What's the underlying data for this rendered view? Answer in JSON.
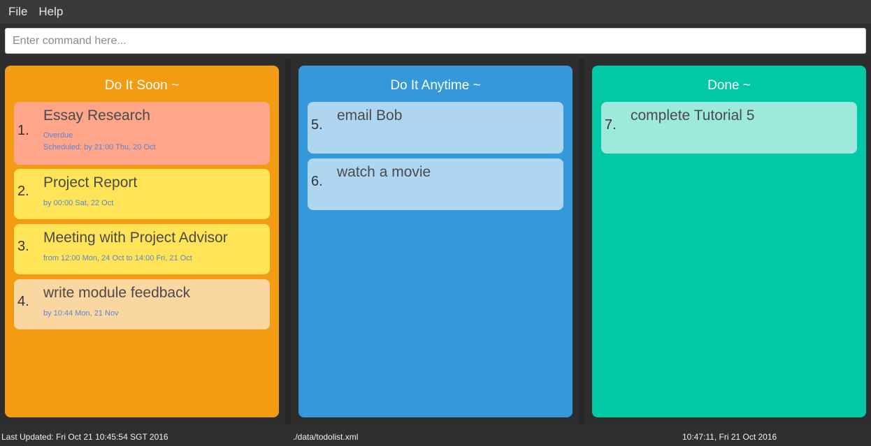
{
  "menu": {
    "file": "File",
    "help": "Help"
  },
  "command": {
    "placeholder": "Enter command here...",
    "value": ""
  },
  "panels": [
    {
      "title": "Do It Soon ~",
      "color": "#f39c12",
      "cards": [
        {
          "num": "1.",
          "title": "Essay Research",
          "lines": [
            "Overdue",
            "Scheduled: by 21:00 Thu, 20 Oct"
          ],
          "color": "#ffa58a"
        },
        {
          "num": "2.",
          "title": "Project Report",
          "lines": [
            "by 00:00 Sat, 22 Oct"
          ],
          "color": "#ffe457"
        },
        {
          "num": "3.",
          "title": "Meeting with Project Advisor",
          "lines": [
            "from 12:00 Mon, 24 Oct to 14:00 Fri, 21 Oct"
          ],
          "color": "#ffe457"
        },
        {
          "num": "4.",
          "title": "write module feedback",
          "lines": [
            "by 10:44 Mon, 21 Nov"
          ],
          "color": "#fad7a0"
        }
      ]
    },
    {
      "title": "Do It Anytime ~",
      "color": "#3598db",
      "cards": [
        {
          "num": "5.",
          "title": "email Bob",
          "lines": [],
          "color": "#aed6f1"
        },
        {
          "num": "6.",
          "title": "watch a movie",
          "lines": [],
          "color": "#aed6f1"
        }
      ]
    },
    {
      "title": "Done ~",
      "color": "#02c9a5",
      "cards": [
        {
          "num": "7.",
          "title": "complete Tutorial 5",
          "lines": [],
          "color": "#9de9dc"
        }
      ]
    }
  ],
  "status": {
    "last_updated": "Last Updated: Fri Oct 21 10:45:54 SGT 2016",
    "file_path": "./data/todolist.xml",
    "clock": "10:47:11, Fri 21 Oct 2016"
  }
}
